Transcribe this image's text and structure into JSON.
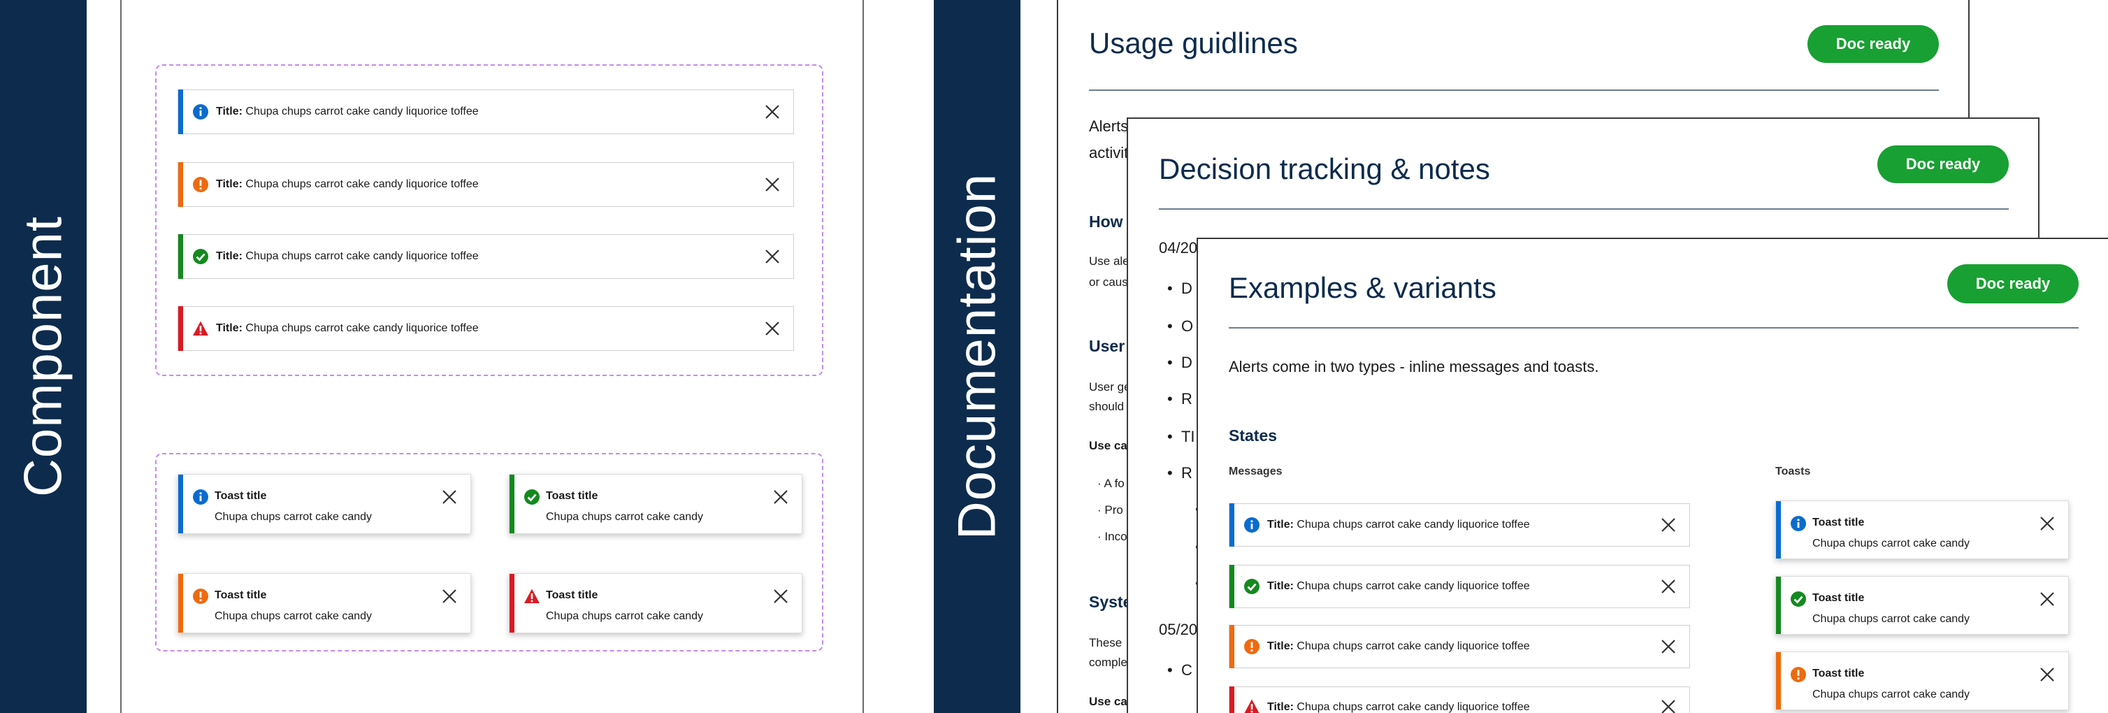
{
  "left_band": {
    "label": "Component"
  },
  "right_band": {
    "label": "Documentation"
  },
  "component": {
    "messages": [
      {
        "type": "info",
        "title": "Title:",
        "text": "Chupa chups carrot cake candy liquorice toffee"
      },
      {
        "type": "warning",
        "title": "Title:",
        "text": "Chupa chups carrot cake candy liquorice toffee"
      },
      {
        "type": "success",
        "title": "Title:",
        "text": "Chupa chups carrot cake candy liquorice toffee"
      },
      {
        "type": "error",
        "title": "Title:",
        "text": "Chupa chups carrot cake candy liquorice toffee"
      }
    ],
    "toasts": [
      {
        "type": "info",
        "title": "Toast title",
        "text": "Chupa chups carrot cake candy"
      },
      {
        "type": "success",
        "title": "Toast title",
        "text": "Chupa chups carrot cake candy"
      },
      {
        "type": "warning",
        "title": "Toast title",
        "text": "Chupa chups carrot cake candy"
      },
      {
        "type": "error",
        "title": "Toast title",
        "text": "Chupa chups carrot cake candy"
      }
    ]
  },
  "docs": {
    "usage": {
      "title": "Usage guidlines",
      "badge": "Doc ready",
      "frags": [
        "Alerts",
        "activit",
        "How t",
        "Use ale",
        "or caus",
        "User",
        "User ge",
        "should",
        "Use ca",
        "A fo",
        "Pro",
        "Inco",
        "Syste",
        "These",
        "comple",
        "Use ca"
      ]
    },
    "decision": {
      "title": "Decision tracking & notes",
      "badge": "Doc ready",
      "date1": "04/20",
      "bullets1": [
        "D",
        "O",
        "D",
        "R",
        "TI",
        "R"
      ],
      "date2": "05/20",
      "bullets2": [
        "C"
      ]
    },
    "examples": {
      "title": "Examples & variants",
      "badge": "Doc ready",
      "intro": "Alerts come in two types - inline messages and toasts.",
      "states_heading": "States",
      "messages_label": "Messages",
      "toasts_label": "Toasts",
      "messages": [
        {
          "type": "info",
          "title": "Title:",
          "text": "Chupa chups carrot cake candy liquorice toffee"
        },
        {
          "type": "success",
          "title": "Title:",
          "text": "Chupa chups carrot cake candy liquorice toffee"
        },
        {
          "type": "warning",
          "title": "Title:",
          "text": "Chupa chups carrot cake candy liquorice toffee"
        },
        {
          "type": "error",
          "title": "Title:",
          "text": "Chupa chups carrot cake candy liquorice toffee"
        }
      ],
      "toasts": [
        {
          "type": "info",
          "title": "Toast title",
          "text": "Chupa chups carrot cake candy"
        },
        {
          "type": "success",
          "title": "Toast title",
          "text": "Chupa chups carrot cake candy"
        },
        {
          "type": "warning",
          "title": "Toast title",
          "text": "Chupa chups carrot cake candy"
        }
      ]
    }
  },
  "colors": {
    "band": "#0d2b4d",
    "info": "#0a6ccf",
    "warning": "#ee6a10",
    "success": "#15891f",
    "error": "#d81b23",
    "badge": "#18a032",
    "heading": "#0d2b4d"
  }
}
